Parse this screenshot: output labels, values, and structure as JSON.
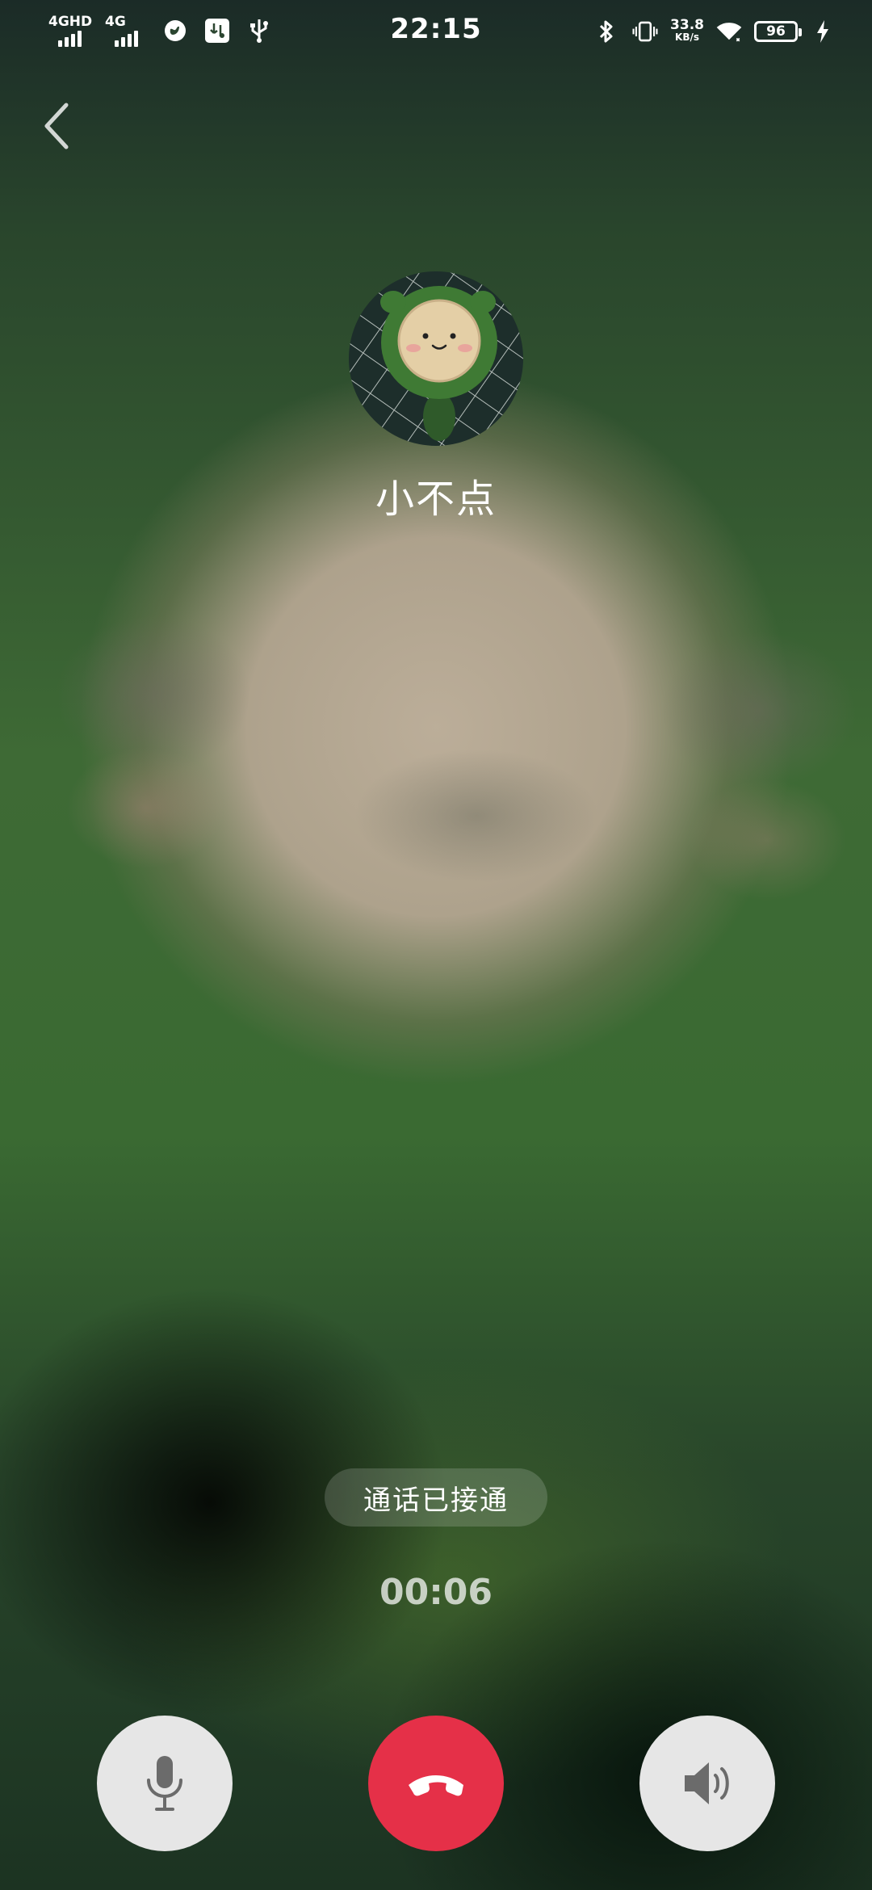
{
  "status_bar": {
    "time": "22:15",
    "sim1_network": "4GHD",
    "sim2_network": "4G",
    "net_speed_value": "33.8",
    "net_speed_unit": "KB/s",
    "battery_level": "96",
    "icons": [
      "signal-icon",
      "signal-icon",
      "vpn-icon",
      "usb-debug-icon",
      "usb-icon",
      "bluetooth-icon",
      "vibrate-icon",
      "wifi-icon",
      "battery-icon",
      "charging-icon"
    ]
  },
  "caller": {
    "name": "小不点"
  },
  "call": {
    "status": "通话已接通",
    "duration": "00:06"
  },
  "controls": {
    "icons": [
      "microphone-icon",
      "hang-up-icon",
      "speaker-icon"
    ],
    "hangup_color": "#e53048"
  }
}
